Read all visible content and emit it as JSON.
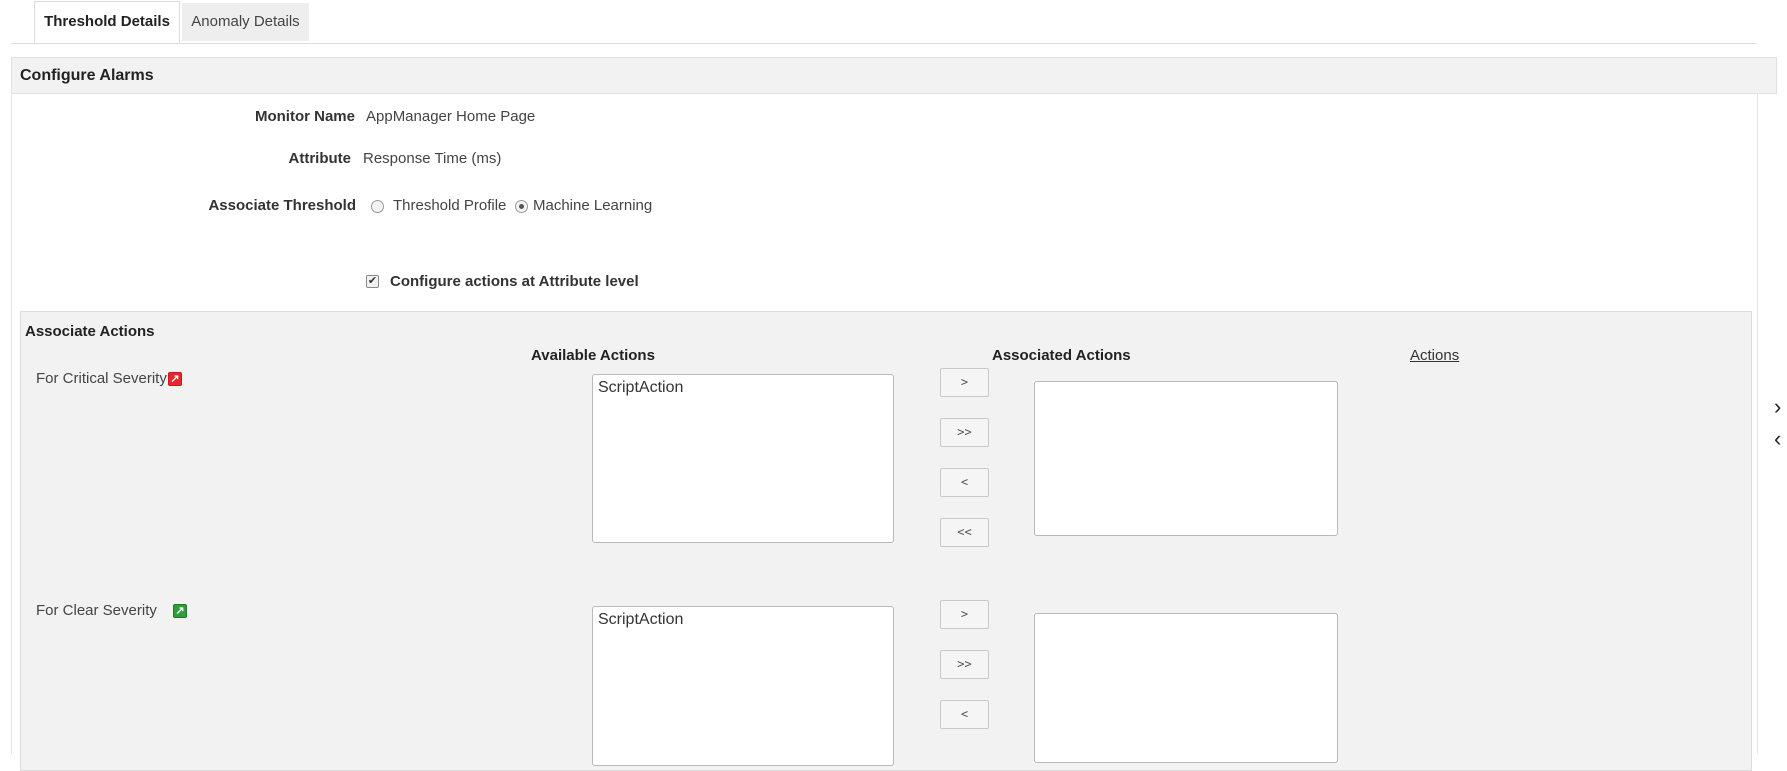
{
  "tabs": [
    {
      "label": "Threshold Details",
      "active": true
    },
    {
      "label": "Anomaly Details",
      "active": false
    }
  ],
  "section": {
    "title": "Configure Alarms"
  },
  "form": {
    "monitor_name_label": "Monitor Name",
    "monitor_name_value": "AppManager Home Page",
    "attribute_label": "Attribute",
    "attribute_value": "Response Time (ms)",
    "associate_threshold_label": "Associate Threshold",
    "threshold_options": [
      {
        "label": "Threshold Profile",
        "selected": false
      },
      {
        "label": "Machine Learning",
        "selected": true
      }
    ],
    "configure_actions_label": "Configure actions at Attribute level",
    "configure_actions_checked": true
  },
  "associate_actions": {
    "title": "Associate Actions",
    "available_header": "Available Actions",
    "associated_header": "Associated Actions",
    "actions_link": "Actions",
    "severities": [
      {
        "label": "For Critical Severity",
        "icon": "edit-icon",
        "icon_color": "#e8262e",
        "available": [
          "ScriptAction"
        ],
        "associated": []
      },
      {
        "label": "For Clear Severity",
        "icon": "edit-icon",
        "icon_color": "#2f9e3a",
        "available": [
          "ScriptAction"
        ],
        "associated": []
      }
    ],
    "move_buttons": {
      "add": ">",
      "add_all": ">>",
      "remove": "<",
      "remove_all": "<<"
    }
  },
  "scroll_chevrons": {
    "up": "›",
    "down": "‹"
  }
}
